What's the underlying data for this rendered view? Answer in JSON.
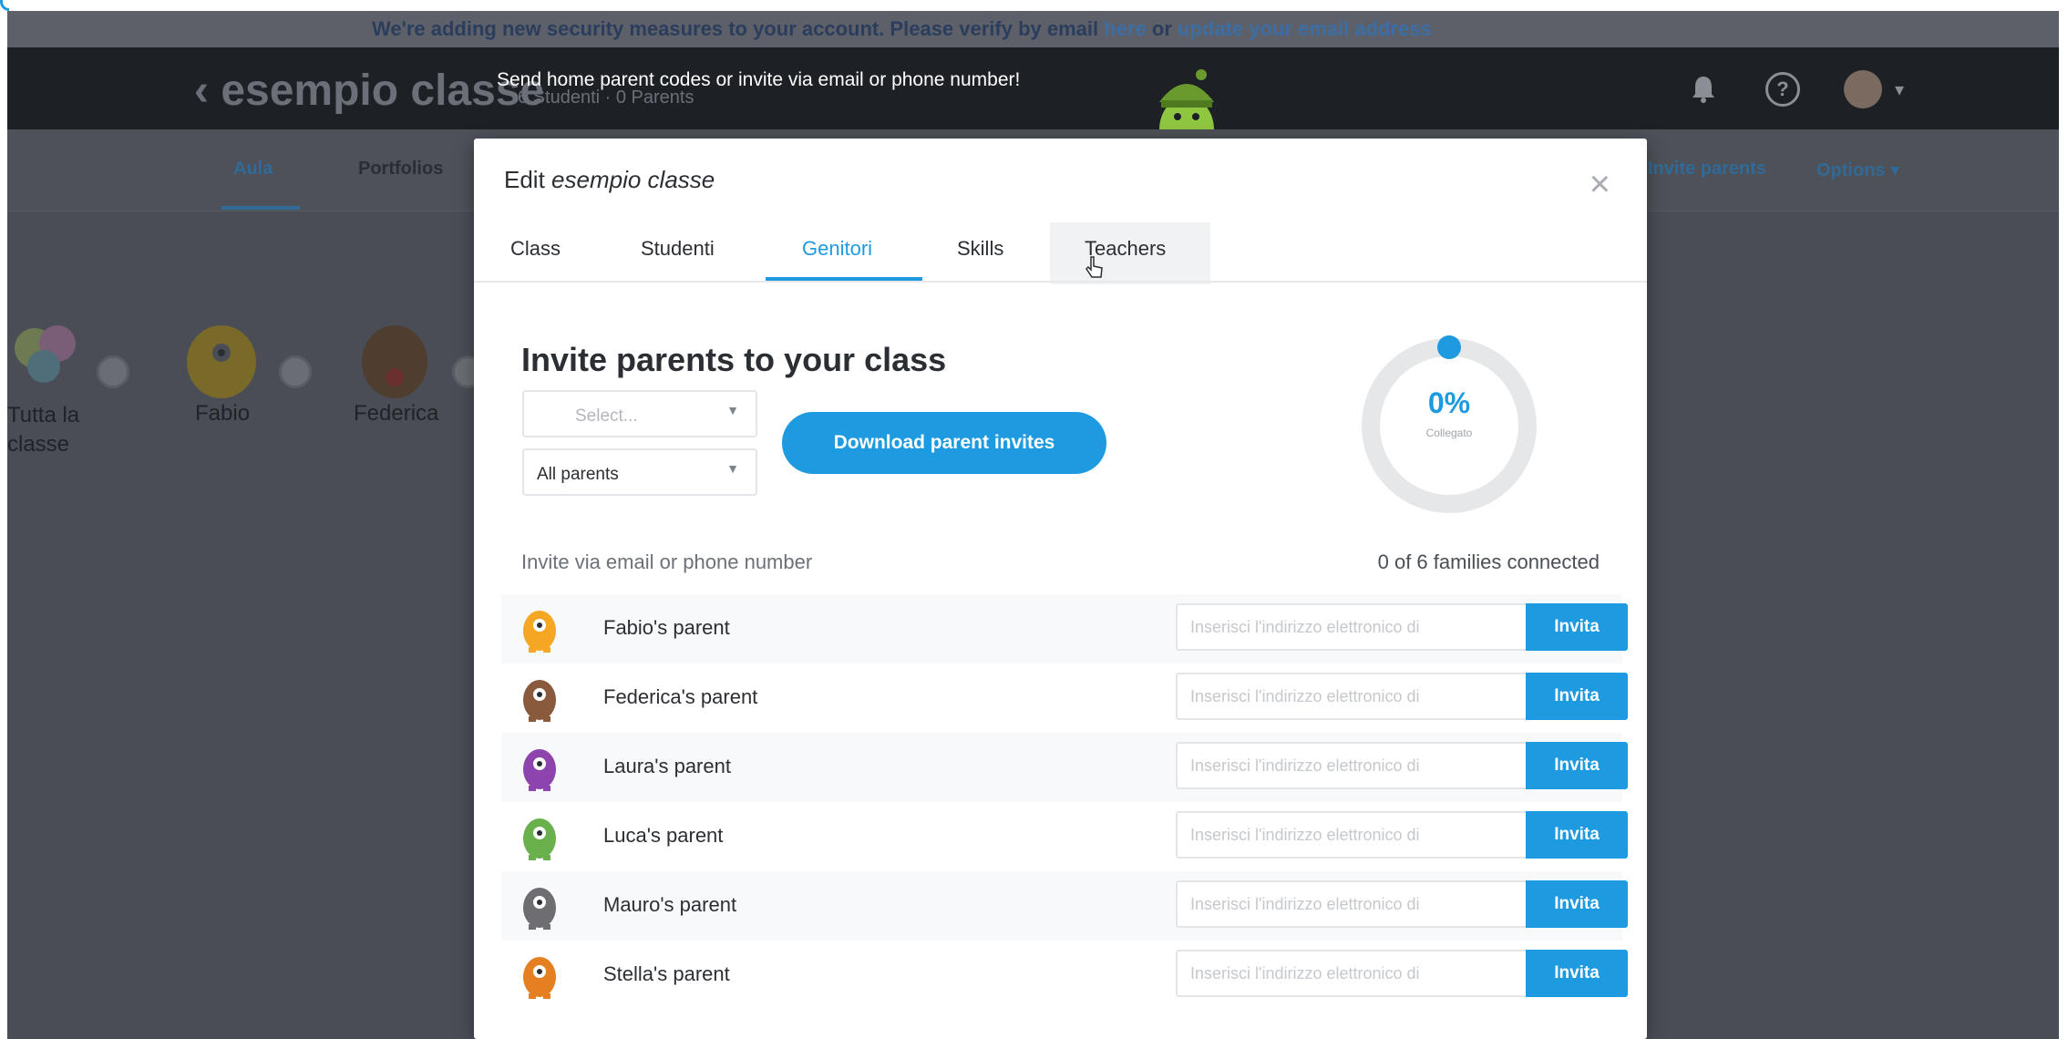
{
  "banner": {
    "text": "We're adding new security measures to your account. Please verify by email",
    "link1": "here",
    "mid": "or",
    "link2": "update your email address"
  },
  "navbar": {
    "back_title": "‹ esempio classe",
    "class_meta": "6 Studenti · 0 Parents",
    "tooltip": "Send home parent codes or invite via email or phone number!"
  },
  "subnav": {
    "tabs": [
      "Aula",
      "Portfolios"
    ],
    "right_items": [
      "Invite parents",
      "Options ▾"
    ]
  },
  "background_students": [
    {
      "name": "Tutta la classe"
    },
    {
      "name": "Fabio"
    },
    {
      "name": "Federica"
    }
  ],
  "modal": {
    "title_prefix": "Edit",
    "title_class": "esempio classe",
    "tabs": [
      "Class",
      "Studenti",
      "Genitori",
      "Skills",
      "Teachers"
    ],
    "active_tab": "Genitori",
    "heading": "Invite parents to your class",
    "select1": "Select...",
    "select2": "All parents",
    "download_button": "Download parent invites",
    "donut_percent": "0%",
    "donut_label": "Collegato",
    "donut_value": 0,
    "invite_label": "Invite via email or phone number",
    "families_connected": "0 of 6 families connected",
    "input_placeholder": "Inserisci l'indirizzo elettronico di",
    "invite_button": "Invita",
    "parents": [
      {
        "name": "Fabio's parent",
        "color": "#f5a623"
      },
      {
        "name": "Federica's parent",
        "color": "#8a5a3c"
      },
      {
        "name": "Laura's parent",
        "color": "#8e44ad"
      },
      {
        "name": "Luca's parent",
        "color": "#6ab04c"
      },
      {
        "name": "Mauro's parent",
        "color": "#6d6d72"
      },
      {
        "name": "Stella's parent",
        "color": "#e67e22"
      }
    ]
  },
  "colors": {
    "accent": "#1e9ae0",
    "navbar": "#1d2126",
    "overlay": "#4a4d55"
  }
}
